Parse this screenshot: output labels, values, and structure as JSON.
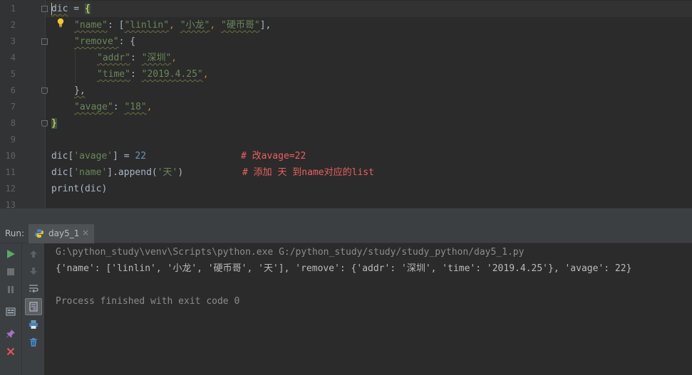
{
  "editor": {
    "line_numbers": [
      "1",
      "2",
      "3",
      "4",
      "5",
      "6",
      "7",
      "8",
      "9",
      "10",
      "11",
      "12",
      "13"
    ],
    "lines": {
      "l1": {
        "a": "dic",
        "b": " = ",
        "c": "{"
      },
      "l2": {
        "key": "\"name\"",
        "colon": ": [",
        "v1": "\"linlin\"",
        "c1": ", ",
        "v2": "\"小龙\"",
        "c2": ", ",
        "v3": "\"硬币哥\"",
        "end": "],"
      },
      "l3": {
        "key": "\"remove\"",
        "colon": ": {"
      },
      "l4": {
        "key": "\"addr\"",
        "colon": ": ",
        "val": "\"深圳\"",
        "end": ","
      },
      "l5": {
        "key": "\"time\"",
        "colon": ": ",
        "val": "\"2019.4.25\"",
        "end": ","
      },
      "l6": {
        "a": "},"
      },
      "l7": {
        "key": "\"avage\"",
        "colon": ": ",
        "val": "\"18\"",
        "end": ","
      },
      "l8": {
        "a": "}"
      },
      "l10": {
        "a": "dic[",
        "key": "'avage'",
        "b": "] = ",
        "num": "22",
        "comment": "# 改avage=22"
      },
      "l11": {
        "a": "dic[",
        "key": "'name'",
        "b": "].append(",
        "val": "'天'",
        "c": ")",
        "comment": "# 添加 天 到name对应的list"
      },
      "l12": {
        "fn": "print",
        "a": "(dic)"
      }
    }
  },
  "run_panel": {
    "label": "Run:",
    "tab_label": "day5_1",
    "tab_close": "×",
    "console": {
      "command": "G:\\python_study\\venv\\Scripts\\python.exe G:/python_study/study/study_python/day5_1.py",
      "output": "{'name': ['linlin', '小龙', '硬币哥', '天'], 'remove': {'addr': '深圳', 'time': '2019.4.25'}, 'avage': 22}",
      "process": "Process finished with exit code 0"
    }
  },
  "icons": {
    "run": "play-icon",
    "stop": "stop-icon",
    "pause": "pause-icon",
    "up": "arrow-up-icon",
    "down": "arrow-down-icon",
    "soft_wrap": "soft-wrap-icon",
    "scroll_end": "scroll-to-end-icon",
    "print": "print-icon",
    "trash": "trash-icon",
    "restore_layout": "layout-icon",
    "pin": "pin-icon",
    "close": "close-icon",
    "bulb": "lightbulb-icon"
  },
  "colors": {
    "string": "#6a8759",
    "number": "#6897bb",
    "comment": "#ee5f5f",
    "play": "#59a869",
    "close": "#e05555"
  }
}
